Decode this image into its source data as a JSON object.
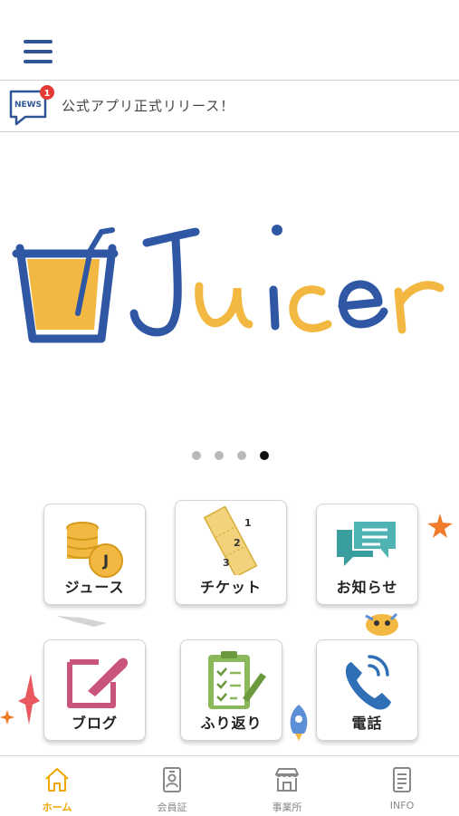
{
  "header": {
    "menu_icon": "hamburger-menu-icon"
  },
  "news": {
    "icon": "news-icon",
    "icon_text": "NEWS",
    "badge_count": "1",
    "headline": "公式アプリ正式リリース！"
  },
  "banner": {
    "logo_text": "Juicer",
    "slide_count": 4,
    "active_slide": 4,
    "colors": {
      "blue": "#2f57a4",
      "yellow": "#f2b842"
    }
  },
  "menu": {
    "tiles": [
      {
        "label": "ジュース",
        "icon": "coins-icon",
        "coin_letter": "J"
      },
      {
        "label": "チケット",
        "icon": "ticket-icon",
        "ticket_numbers": [
          "1",
          "2",
          "3"
        ]
      },
      {
        "label": "お知らせ",
        "icon": "chat-bubbles-icon"
      },
      {
        "label": "ブログ",
        "icon": "pen-icon"
      },
      {
        "label": "ふり返り",
        "icon": "clipboard-icon"
      },
      {
        "label": "電話",
        "icon": "phone-icon"
      }
    ]
  },
  "tabbar": {
    "tabs": [
      {
        "label": "ホーム",
        "icon": "home-icon",
        "active": true
      },
      {
        "label": "会員証",
        "icon": "id-card-icon",
        "active": false
      },
      {
        "label": "事業所",
        "icon": "shop-icon",
        "active": false
      },
      {
        "label": "INFO",
        "icon": "document-icon",
        "active": false
      }
    ],
    "active_color": "#f0a800"
  }
}
